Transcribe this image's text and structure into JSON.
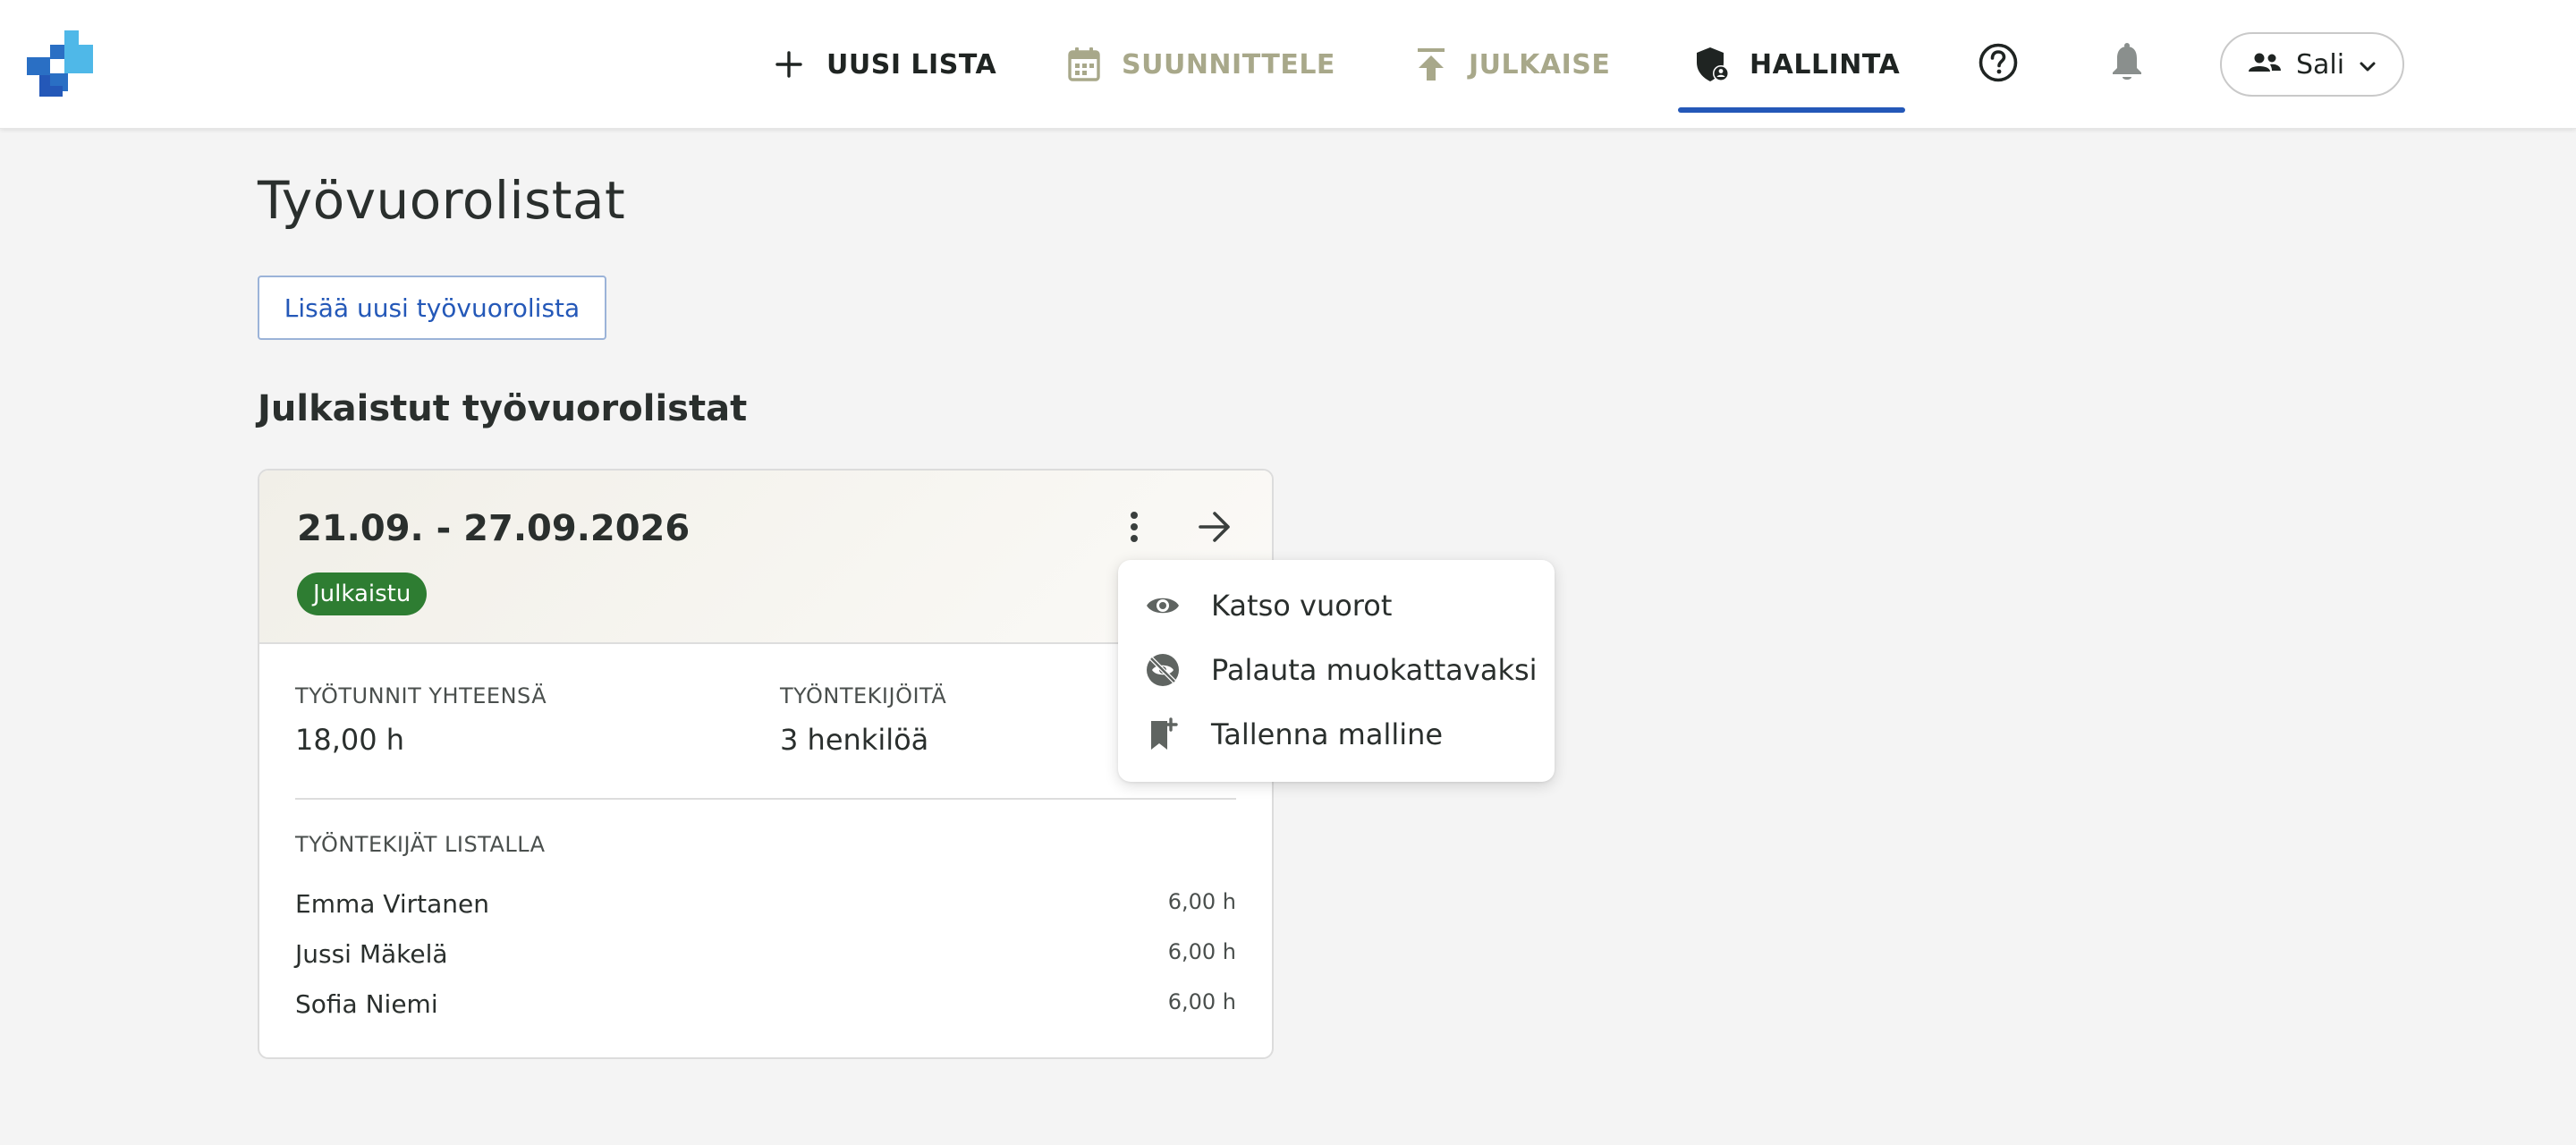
{
  "nav": {
    "items": [
      {
        "label": "UUSI LISTA",
        "icon": "plus-icon"
      },
      {
        "label": "SUUNNITTELE",
        "icon": "calendar-icon"
      },
      {
        "label": "JULKAISE",
        "icon": "publish-icon"
      },
      {
        "label": "HALLINTA",
        "icon": "shield-user-icon",
        "active": true
      }
    ],
    "help_icon": "help-circle-icon",
    "bell_icon": "bell-icon",
    "user": {
      "label": "Sali",
      "icon": "people-icon"
    },
    "colors": {
      "active_underline": "#2458b8",
      "muted": "#a8a88a"
    }
  },
  "page": {
    "title": "Työvuorolistat",
    "add_button": "Lisää uusi työvuorolista",
    "section_title": "Julkaistut työvuorolistat"
  },
  "card": {
    "date_range": "21.09. - 27.09.2026",
    "status": "Julkaistu",
    "status_color": "#2e7d32",
    "hours_label": "TYÖTUNNIT YHTEENSÄ",
    "hours_value": "18,00 h",
    "employees_label": "TYÖNTEKIJÖITÄ",
    "employees_value": "3 henkilöä",
    "list_label": "TYÖNTEKIJÄT LISTALLA",
    "employees": [
      {
        "name": "Emma Virtanen",
        "hours": "6,00 h"
      },
      {
        "name": "Jussi Mäkelä",
        "hours": "6,00 h"
      },
      {
        "name": "Sofia Niemi",
        "hours": "6,00 h"
      }
    ]
  },
  "menu": {
    "items": [
      {
        "label": "Katso vuorot",
        "icon": "eye-icon"
      },
      {
        "label": "Palauta muokattavaksi",
        "icon": "eye-off-icon"
      },
      {
        "label": "Tallenna malline",
        "icon": "bookmark-add-icon"
      }
    ]
  }
}
